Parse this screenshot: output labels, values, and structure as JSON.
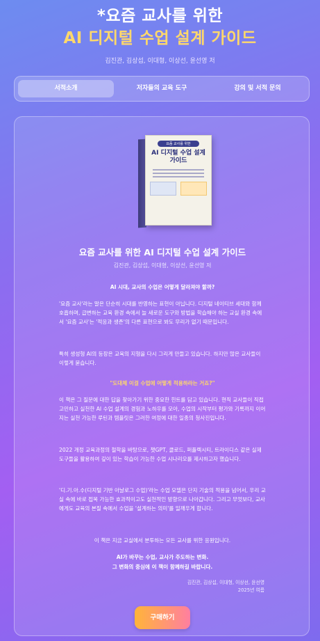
{
  "header": {
    "title_line1": "*요즘 교사를 위한",
    "title_line2": "AI 디지털 수업 설계 가이드",
    "authors": "김진관, 김상섭, 이대형, 이상선, 윤선영 저"
  },
  "tabs": [
    {
      "label": "서적소개",
      "active": true
    },
    {
      "label": "저자들의 교육 도구",
      "active": false
    },
    {
      "label": "강의 및 서적 문의",
      "active": false
    }
  ],
  "book_cover": {
    "subtitle": "요즘 교사를 위한",
    "title": "AI 디지털 수업 설계 가이드"
  },
  "book": {
    "title": "요즘 교사를 위한 AI 디지털 수업 설계 가이드",
    "authors": "김진관, 김상섭, 이대형, 이상선, 윤선영 저"
  },
  "content": {
    "heading": "AI 시대, 교사의 수업은 어떻게 달라져야 할까?",
    "p1": "'요즘 교사'라는 말은 단순히 시대를 반영하는 표현이 아닙니다. 디지털 네이티브 세대와 함께 호흡하며, 급변하는 교육 환경 속에서 늘 새로운 도구와 방법을 학습해야 하는 교실 환경 속에서 '요즘 교사'는 '적응과 생존'의 다른 표현으로 봐도 무리가 없기 때문입니다.",
    "p2": "특히 생성형 AI의 등장은 교육의 지형을 다시 그리게 만들고 있습니다. 하지만 많은 교사들이 이렇게 묻습니다.",
    "quote": "\"도대체 이걸 수업에 어떻게 적용하라는 거죠?\"",
    "p3": "이 책은 그 질문에 대한 답을 찾아가기 위한 중요한 힌트를 담고 있습니다. 현직 교사들이 직접 고민하고 실천한 AI 수업 설계의 경험과 노하우를 모아, 수업의 시작부터 평가와 기록까지 이어지는 실천 가능한 루틴과 템플릿은 그러한 여정에 대한 일종의 청사진입니다.",
    "p4": "2022 개정 교육과정의 철학을 바탕으로, 챗GPT, 클로드, 퍼플렉시티, 트라이디스 같은 실제 도구들을 활용하여 깊이 있는 학습이 가능한 수업 시나리오를 제시하고자 했습니다.",
    "p5": "'디.기.아.수(디지털 기반 아날로그 수업)'라는 수업 모델은 단지 기술의 적용을 넘어서, 우리 교실 속에 바로 접목 가능한 효과적이고도 실천적인 방향으로 나아갑니다. 그리고 무엇보다, 교사에게도 교육의 본질 속에서 수업을 '설계하는 의미'를 일깨우게 합니다.",
    "p6": "이 책은 지금 교실에서 분투하는 모든 교사를 위한 응원입니다.",
    "closing1": "AI가 바꾸는 수업, 교사가 주도하는 변화.",
    "closing2": "그 변화의 중심에 이 책이 함께하길 바랍니다.",
    "signature_names": "김진관, 김상섭, 이대형, 이상선, 윤선영",
    "signature_date": "2025년 여름"
  },
  "buy_button": {
    "label": "구매하기"
  },
  "colors": {
    "accent_gold": "#ffd86b",
    "button_start": "#ffb43a",
    "button_end": "#ff7fa0"
  }
}
